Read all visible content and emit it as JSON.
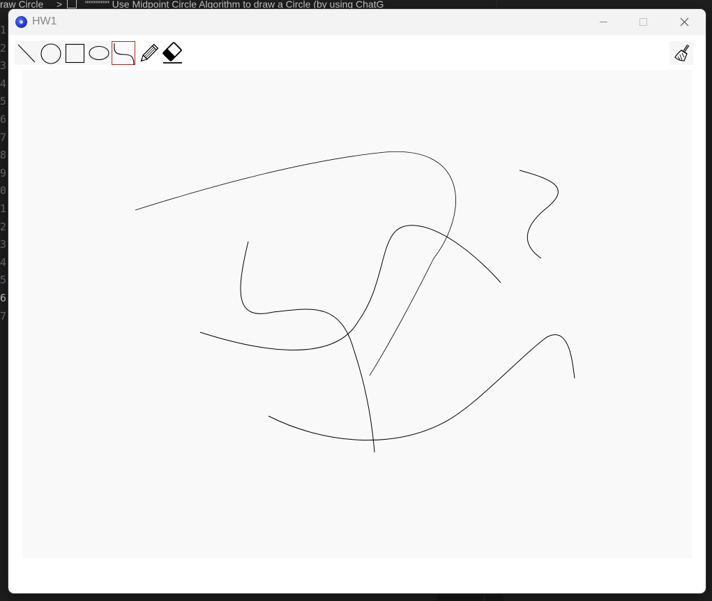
{
  "editor": {
    "tab_text_left": "raw Circle",
    "tab_separator": ">",
    "tab_text_right": "\"\"\"\"\"\"\" Use Midpoint Circle Algorithm to draw a Circle (by using ChatG",
    "line_numbers": [
      "1",
      "2",
      "3",
      "4",
      "5",
      "6",
      "7",
      "8",
      "9",
      "0",
      "1",
      "2",
      "3",
      "4",
      "5",
      "6",
      "7"
    ],
    "active_line_index": 15
  },
  "window": {
    "title": "HW1",
    "minimize_label": "Minimize",
    "maximize_label": "Maximize",
    "close_label": "Close"
  },
  "toolbar": {
    "tools": [
      {
        "id": "line",
        "icon": "line-icon"
      },
      {
        "id": "circle",
        "icon": "circle-icon"
      },
      {
        "id": "rectangle",
        "icon": "rectangle-icon"
      },
      {
        "id": "ellipse",
        "icon": "ellipse-icon"
      },
      {
        "id": "curve",
        "icon": "curve-icon",
        "selected": true
      },
      {
        "id": "pencil",
        "icon": "pencil-icon"
      },
      {
        "id": "eraser",
        "icon": "eraser-icon"
      }
    ],
    "clear_tool": {
      "id": "clear",
      "icon": "broom-icon"
    },
    "selected_border_color": "#b22222"
  },
  "canvas": {
    "background_color": "#f9f9f9",
    "stroke_color": "#000000",
    "curve_count": 6
  }
}
